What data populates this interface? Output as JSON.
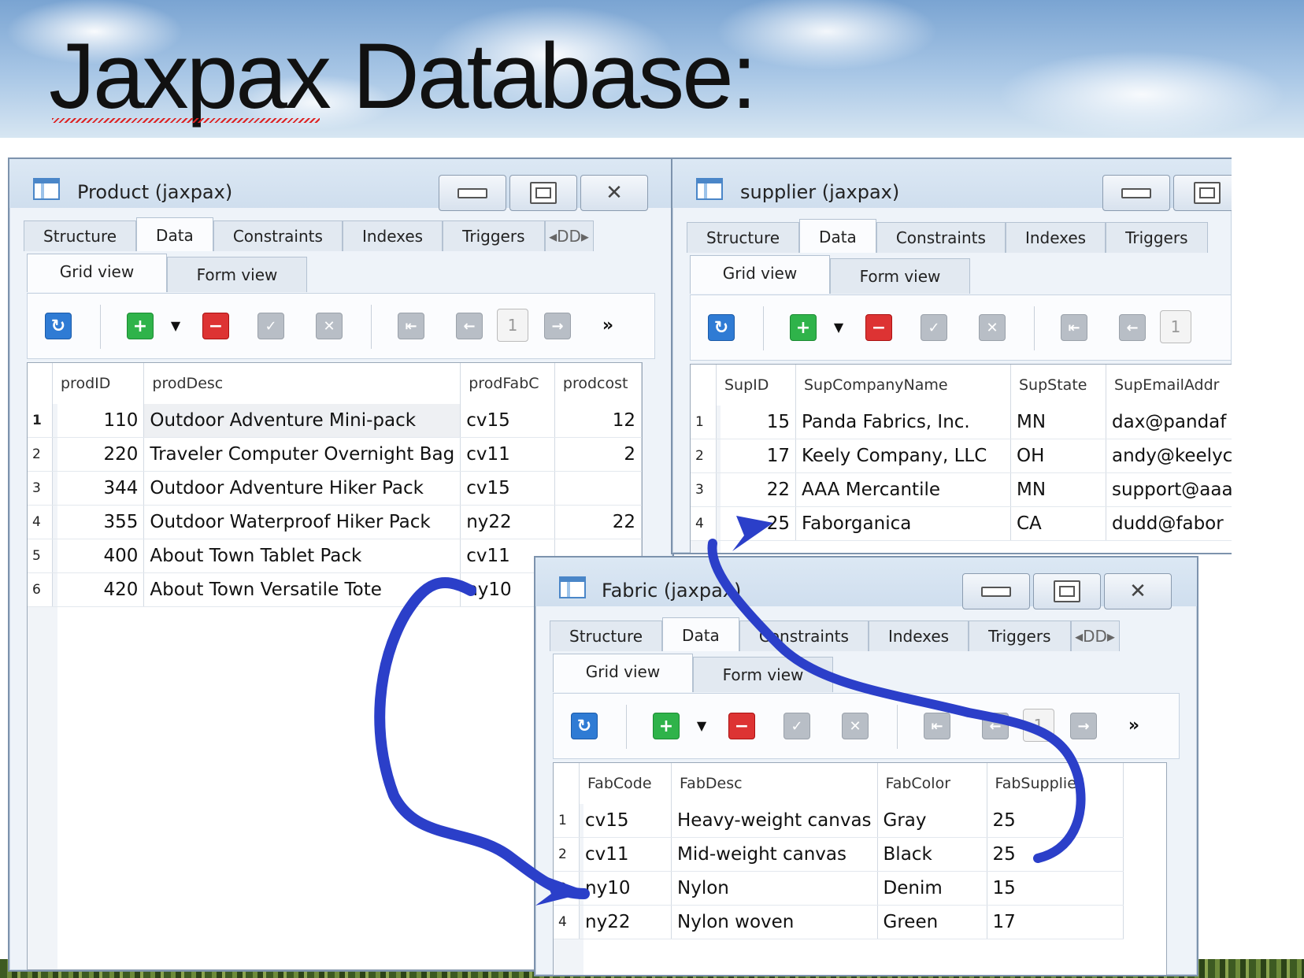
{
  "slide": {
    "title": "Jaxpax Database:"
  },
  "product_window": {
    "title": "Product (jaxpax)",
    "tabs": [
      "Structure",
      "Data",
      "Constraints",
      "Indexes",
      "Triggers"
    ],
    "tab_overflow": "◂DD▸",
    "subtabs": [
      "Grid view",
      "Form view"
    ],
    "page_number": "1",
    "more_label": "»",
    "columns": [
      "prodID",
      "prodDesc",
      "prodFabC",
      "prodcost"
    ],
    "rows": [
      {
        "n": "1",
        "cells": [
          "110",
          "Outdoor Adventure Mini-pack",
          "cv15",
          "12"
        ]
      },
      {
        "n": "2",
        "cells": [
          "220",
          "Traveler Computer Overnight Bag",
          "cv11",
          "2"
        ]
      },
      {
        "n": "3",
        "cells": [
          "344",
          "Outdoor Adventure Hiker Pack",
          "cv15",
          ""
        ]
      },
      {
        "n": "4",
        "cells": [
          "355",
          "Outdoor Waterproof Hiker Pack",
          "ny22",
          "22"
        ]
      },
      {
        "n": "5",
        "cells": [
          "400",
          "About Town Tablet Pack",
          "cv11",
          ""
        ]
      },
      {
        "n": "6",
        "cells": [
          "420",
          "About Town Versatile Tote",
          "ny10",
          ""
        ]
      }
    ]
  },
  "supplier_window": {
    "title": "supplier (jaxpax)",
    "tabs": [
      "Structure",
      "Data",
      "Constraints",
      "Indexes",
      "Triggers"
    ],
    "subtabs": [
      "Grid view",
      "Form view"
    ],
    "page_number": "1",
    "columns": [
      "SupID",
      "SupCompanyName",
      "SupState",
      "SupEmailAddr"
    ],
    "rows": [
      {
        "n": "1",
        "cells": [
          "15",
          "Panda Fabrics, Inc.",
          "MN",
          "dax@pandaf"
        ]
      },
      {
        "n": "2",
        "cells": [
          "17",
          "Keely Company, LLC",
          "OH",
          "andy@keelyc"
        ]
      },
      {
        "n": "3",
        "cells": [
          "22",
          "AAA Mercantile",
          "MN",
          "support@aaa"
        ]
      },
      {
        "n": "4",
        "cells": [
          "25",
          "Faborganica",
          "CA",
          "dudd@fabor"
        ]
      }
    ]
  },
  "fabric_window": {
    "title": "Fabric (jaxpax)",
    "tabs": [
      "Structure",
      "Data",
      "Constraints",
      "Indexes",
      "Triggers"
    ],
    "tab_overflow": "◂DD▸",
    "subtabs": [
      "Grid view",
      "Form view"
    ],
    "page_number": "1",
    "more_label": "»",
    "columns": [
      "FabCode",
      "FabDesc",
      "FabColor",
      "FabSupplier"
    ],
    "rows": [
      {
        "n": "1",
        "cells": [
          "cv15",
          "Heavy-weight canvas",
          "Gray",
          "25"
        ]
      },
      {
        "n": "2",
        "cells": [
          "cv11",
          "Mid-weight canvas",
          "Black",
          "25"
        ]
      },
      {
        "n": "3",
        "cells": [
          "ny10",
          "Nylon",
          "Denim",
          "15"
        ]
      },
      {
        "n": "4",
        "cells": [
          "ny22",
          "Nylon woven",
          "Green",
          "17"
        ]
      }
    ]
  },
  "annotation_color": "#2b3fc9"
}
